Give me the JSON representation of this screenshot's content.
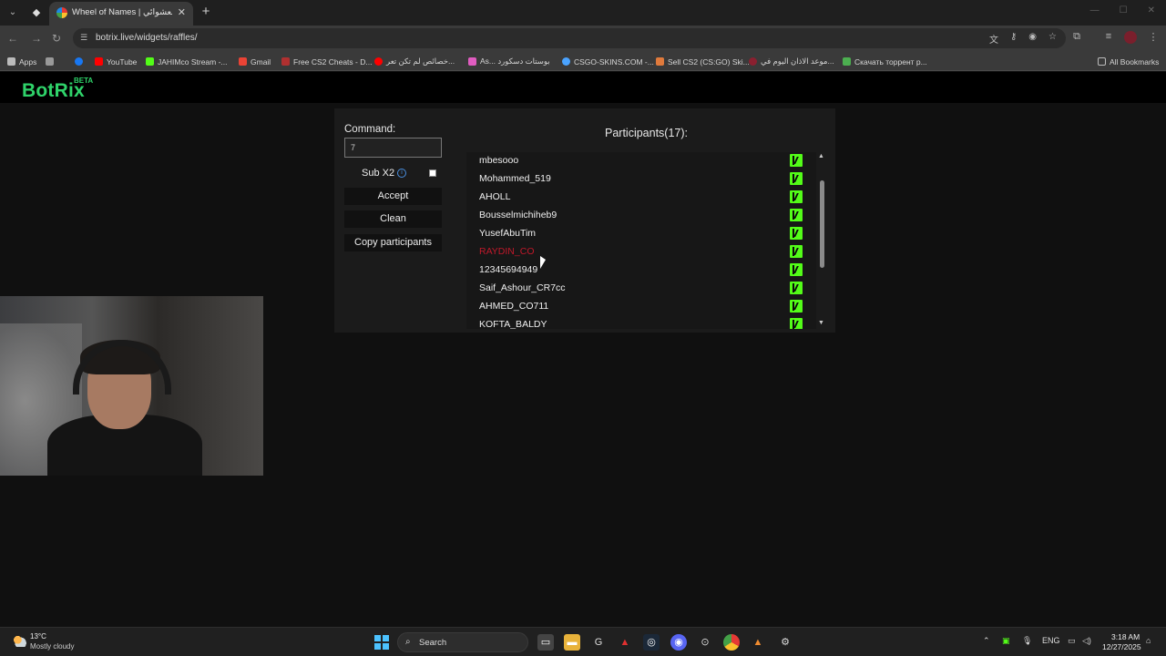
{
  "browser": {
    "tab_title": "Wheel of Names | اسم العشوائي",
    "url": "botrix.live/widgets/raffles/",
    "bookmarks": [
      {
        "label": "Apps",
        "color": "#cccccc"
      },
      {
        "label": "YouTube",
        "color": "#ff0000"
      },
      {
        "label": "JAHIMco Stream -...",
        "color": "#53fc18"
      },
      {
        "label": "Gmail",
        "color": "#ea4335"
      },
      {
        "label": "Free CS2 Cheats - D...",
        "color": "#b03030"
      },
      {
        "label": "خصائص لم تكن تعر...",
        "color": "#ff0000"
      },
      {
        "label": "As... بوستات دسكورد",
        "color": "#e05cc0"
      },
      {
        "label": "CSGO-SKINS.COM -...",
        "color": "#4aa3ff"
      },
      {
        "label": "Sell CS2 (CS:GO) Ski...",
        "color": "#e07a3c"
      },
      {
        "label": "موعد الاذان اليوم في...",
        "color": "#8a2030"
      },
      {
        "label": "Скачать торрент р...",
        "color": "#4caf50"
      },
      {
        "label": "All Bookmarks",
        "color": "#cccccc"
      }
    ]
  },
  "site": {
    "logo": "BotRix",
    "logo_badge": "BETA"
  },
  "raffle": {
    "command_label": "Command:",
    "command_value": "7",
    "sub_label": "Sub X2",
    "sub_checked": false,
    "buttons": {
      "accept": "Accept",
      "clean": "Clean",
      "copy": "Copy participants"
    },
    "participants_title": "Participants(17):",
    "participants": [
      {
        "name": "mbesooo",
        "highlight": false,
        "platform_icon": "kick-icon"
      },
      {
        "name": "Mohammed_519",
        "highlight": false,
        "platform_icon": "kick-icon"
      },
      {
        "name": "AHOLL",
        "highlight": false,
        "platform_icon": "kick-icon"
      },
      {
        "name": "Bousselmichiheb9",
        "highlight": false,
        "platform_icon": "kick-icon"
      },
      {
        "name": "YusefAbuTim",
        "highlight": false,
        "platform_icon": "kick-icon"
      },
      {
        "name": "RAYDIN_CO",
        "highlight": true,
        "platform_icon": "kick-icon"
      },
      {
        "name": "12345694949",
        "highlight": false,
        "platform_icon": "kick-icon"
      },
      {
        "name": "Saif_Ashour_CR7cc",
        "highlight": false,
        "platform_icon": "kick-icon"
      },
      {
        "name": "AHMED_CO711",
        "highlight": false,
        "platform_icon": "kick-icon"
      },
      {
        "name": "KOFTA_BALDY",
        "highlight": false,
        "platform_icon": "kick-icon"
      }
    ]
  },
  "taskbar": {
    "weather_temp": "13°C",
    "weather_desc": "Mostly cloudy",
    "search_placeholder": "Search",
    "lang": "ENG",
    "time": "3:18 AM",
    "date": "12/27/2025"
  }
}
